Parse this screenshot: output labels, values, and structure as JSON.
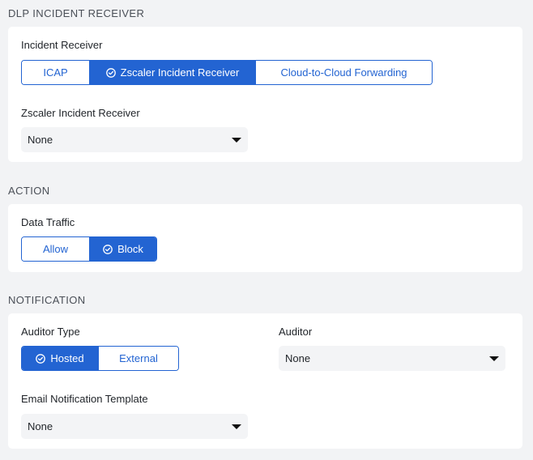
{
  "sections": {
    "dlp": {
      "title": "DLP INCIDENT RECEIVER",
      "incident_receiver_label": "Incident Receiver",
      "receiver_options": [
        "ICAP",
        "Zscaler Incident Receiver",
        "Cloud-to-Cloud Forwarding"
      ],
      "receiver_selected": "Zscaler Incident Receiver",
      "zscaler_receiver_label": "Zscaler Incident Receiver",
      "zscaler_receiver_value": "None"
    },
    "action": {
      "title": "ACTION",
      "data_traffic_label": "Data Traffic",
      "options": [
        "Allow",
        "Block"
      ],
      "selected": "Block"
    },
    "notification": {
      "title": "NOTIFICATION",
      "auditor_type_label": "Auditor Type",
      "auditor_type_options": [
        "Hosted",
        "External"
      ],
      "auditor_type_selected": "Hosted",
      "auditor_label": "Auditor",
      "auditor_value": "None",
      "email_template_label": "Email Notification Template",
      "email_template_value": "None"
    }
  },
  "colors": {
    "accent": "#2364d2",
    "card_bg": "#ffffff",
    "page_bg": "#f2f3f5",
    "select_bg": "#f3f4f6"
  },
  "icons": [
    "check-circle-icon",
    "caret-down-icon"
  ]
}
